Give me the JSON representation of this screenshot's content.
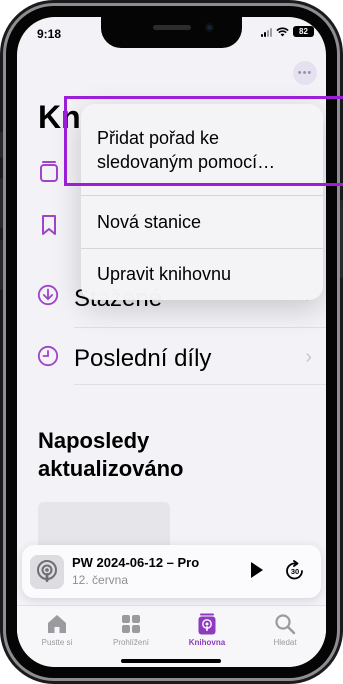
{
  "status_bar": {
    "time": "9:18",
    "battery": "82"
  },
  "header": {
    "title": "Kn"
  },
  "library_items": [
    {
      "label": "Stažené",
      "icon": "download-icon"
    },
    {
      "label": "Poslední díly",
      "icon": "clock-icon"
    }
  ],
  "context_menu": {
    "items": [
      {
        "label_line1": "Přidat pořad ke",
        "label_line2": "sledovaným pomocí…"
      },
      {
        "label": "Nová stanice"
      },
      {
        "label": "Upravit knihovnu"
      }
    ]
  },
  "section": {
    "title_line1": "Naposledy",
    "title_line2": "aktualizováno"
  },
  "mini_player": {
    "title": "PW 2024-06-12 – Pro",
    "subtitle": "12. června",
    "skip_seconds": "30"
  },
  "tab_bar": {
    "tabs": [
      {
        "label": "Pustte si",
        "icon": "home-icon"
      },
      {
        "label": "Prohlížení",
        "icon": "browse-grid-icon"
      },
      {
        "label": "Knihovna",
        "icon": "library-icon"
      },
      {
        "label": "Hledat",
        "icon": "search-icon"
      }
    ],
    "active": "Knihovna"
  },
  "colors": {
    "accent": "#8e3ac1",
    "highlight": "#9a1fd6",
    "background": "#f2f2f7"
  }
}
